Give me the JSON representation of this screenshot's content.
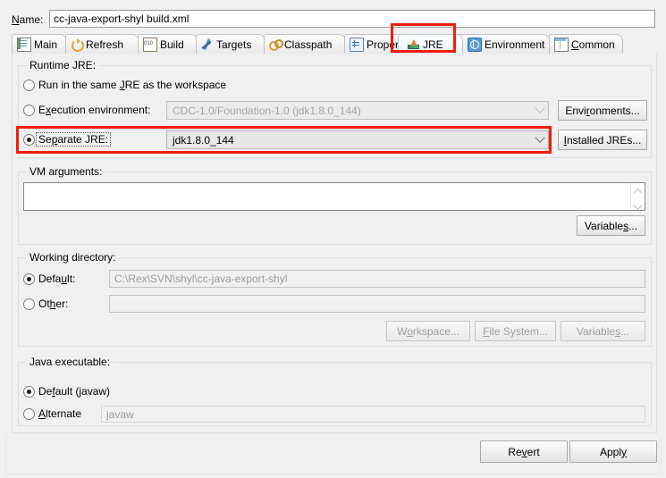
{
  "dialog": {
    "name_label": "Name:",
    "name_value": "cc-java-export-shyl build.xml"
  },
  "tabs": [
    {
      "label": "Main",
      "icon": "document-icon",
      "active": false
    },
    {
      "label": "Refresh",
      "icon": "refresh-icon",
      "active": false
    },
    {
      "label": "Build",
      "icon": "build-icon",
      "active": false
    },
    {
      "label": "Targets",
      "icon": "targets-icon",
      "active": false
    },
    {
      "label": "Classpath",
      "icon": "classpath-icon",
      "active": false
    },
    {
      "label": "Properties",
      "icon": "properties-icon",
      "active": false
    },
    {
      "label": "JRE",
      "icon": "jre-icon",
      "active": true
    },
    {
      "label": "Environment",
      "icon": "environment-icon",
      "active": false
    },
    {
      "label": "Common",
      "icon": "common-icon",
      "active": false
    }
  ],
  "runtime_jre": {
    "group_title": "Runtime JRE:",
    "option_workspace": "Run in the same JRE as the workspace",
    "option_exec_env": "Execution environment:",
    "exec_env_value": "CDC-1.0/Foundation-1.0 (jdk1.8.0_144)",
    "environments_button": "Environments...",
    "option_separate": "Separate JRE:",
    "separate_value": "jdk1.8.0_144",
    "installed_jres_button": "Installed JREs...",
    "selected": "separate"
  },
  "vm_arguments": {
    "group_title": "VM arguments:",
    "value": "",
    "variables_button": "Variables..."
  },
  "working_directory": {
    "group_title": "Working directory:",
    "option_default": "Default:",
    "default_value": "C:\\Rex\\SVN\\shyl\\cc-java-export-shyl",
    "option_other": "Other:",
    "other_value": "",
    "workspace_button": "Workspace...",
    "file_system_button": "File System...",
    "variables_button": "Variables...",
    "selected": "default"
  },
  "java_executable": {
    "group_title": "Java executable:",
    "option_default": "Default (javaw)",
    "option_alternate": "Alternate",
    "alternate_value": "javaw",
    "selected": "default"
  },
  "footer": {
    "revert_button": "Revert",
    "apply_button": "Apply"
  },
  "annotations": {
    "highlight_color": "#f41c0c",
    "boxes": [
      "jre-tab",
      "separate-jre-row"
    ]
  }
}
